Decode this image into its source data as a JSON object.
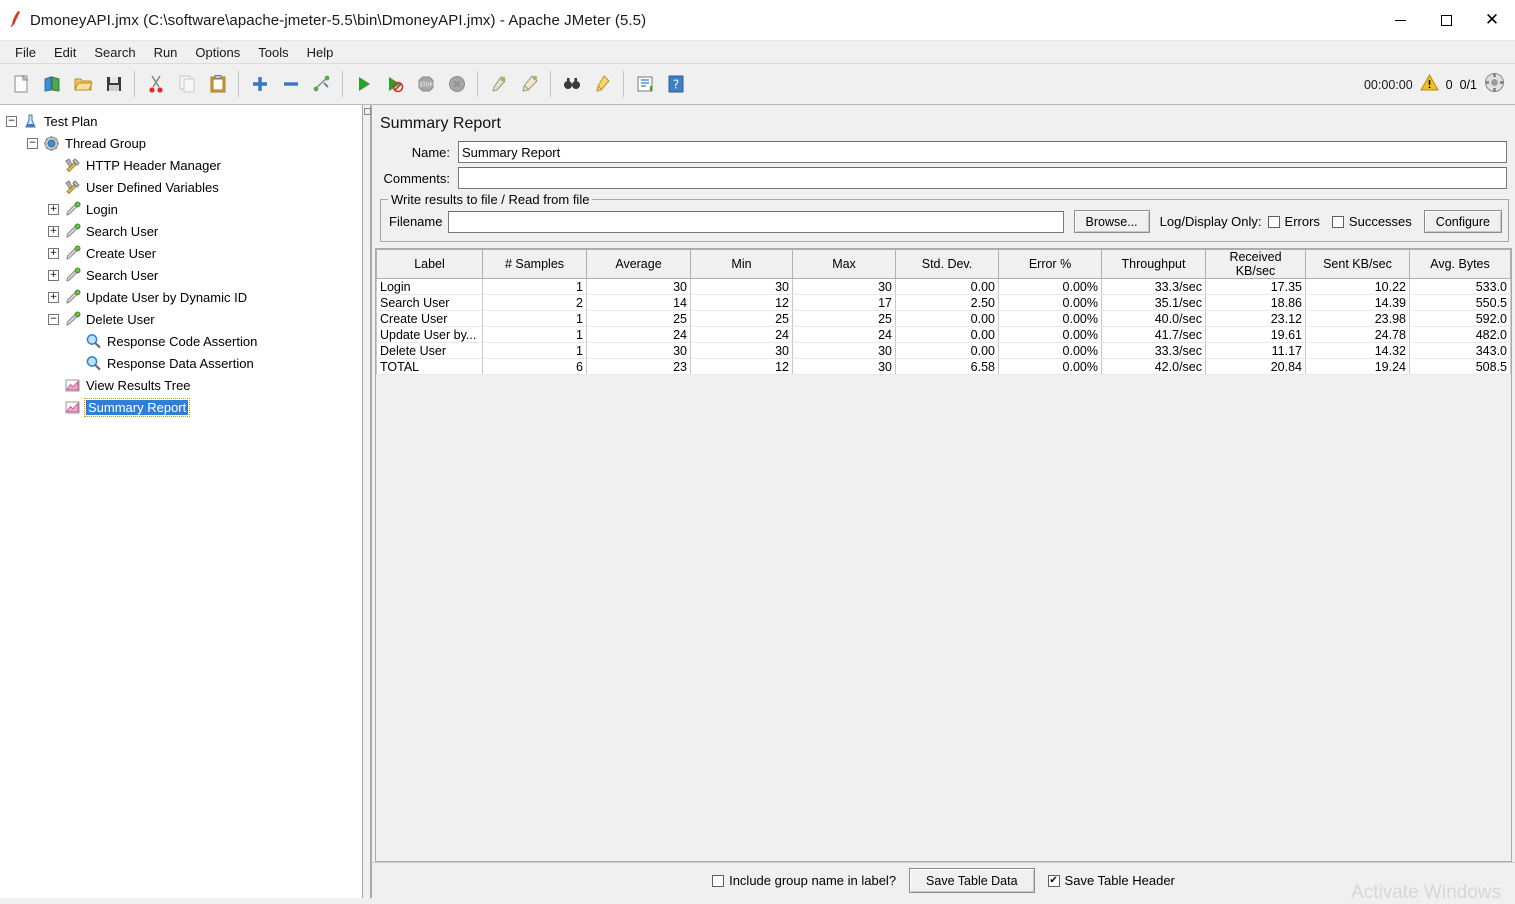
{
  "window": {
    "title": "DmoneyAPI.jmx (C:\\software\\apache-jmeter-5.5\\bin\\DmoneyAPI.jmx) - Apache JMeter (5.5)",
    "app_icon": "jmeter-feather-icon",
    "minimize": "minimize-icon",
    "maximize": "maximize-icon",
    "close": "close-icon"
  },
  "menu": {
    "items": [
      "File",
      "Edit",
      "Search",
      "Run",
      "Options",
      "Tools",
      "Help"
    ]
  },
  "toolbar": {
    "buttons": [
      {
        "name": "new-icon",
        "group": 0
      },
      {
        "name": "templates-icon",
        "group": 0
      },
      {
        "name": "open-icon",
        "group": 0
      },
      {
        "name": "save-icon",
        "group": 0
      },
      {
        "name": "cut-icon",
        "group": 1
      },
      {
        "name": "copy-icon",
        "group": 1
      },
      {
        "name": "paste-icon",
        "group": 1
      },
      {
        "name": "expand-icon",
        "group": 2
      },
      {
        "name": "collapse-icon",
        "group": 2
      },
      {
        "name": "toggle-icon",
        "group": 2
      },
      {
        "name": "start-icon",
        "group": 3
      },
      {
        "name": "start-no-timers-icon",
        "group": 3
      },
      {
        "name": "stop-icon",
        "group": 3
      },
      {
        "name": "shutdown-icon",
        "group": 3
      },
      {
        "name": "clear-icon",
        "group": 4
      },
      {
        "name": "clear-all-icon",
        "group": 4
      },
      {
        "name": "search-icon",
        "group": 5
      },
      {
        "name": "reset-search-icon",
        "group": 5
      },
      {
        "name": "function-helper-icon",
        "group": 6
      },
      {
        "name": "help-icon",
        "group": 6
      }
    ],
    "timer": "00:00:00",
    "warning_icon": "warning-triangle-icon",
    "error_count": "0",
    "thread_count": "0/1",
    "status_icon": "thread-status-icon"
  },
  "tree": {
    "nodes": [
      {
        "label": "Test Plan",
        "depth": 0,
        "icon": "test-plan-icon",
        "handle": "minus",
        "selected": false
      },
      {
        "label": "Thread Group",
        "depth": 1,
        "icon": "thread-group-icon",
        "handle": "minus",
        "selected": false
      },
      {
        "label": "HTTP Header Manager",
        "depth": 2,
        "icon": "config-element-icon",
        "handle": "none",
        "selected": false
      },
      {
        "label": "User Defined Variables",
        "depth": 2,
        "icon": "config-element-icon",
        "handle": "none",
        "selected": false
      },
      {
        "label": "Login",
        "depth": 2,
        "icon": "http-sampler-icon",
        "handle": "plus",
        "selected": false
      },
      {
        "label": "Search User",
        "depth": 2,
        "icon": "http-sampler-icon",
        "handle": "plus",
        "selected": false
      },
      {
        "label": "Create User",
        "depth": 2,
        "icon": "http-sampler-icon",
        "handle": "plus",
        "selected": false
      },
      {
        "label": "Search User",
        "depth": 2,
        "icon": "http-sampler-icon",
        "handle": "plus",
        "selected": false
      },
      {
        "label": "Update User by Dynamic ID",
        "depth": 2,
        "icon": "http-sampler-icon",
        "handle": "plus",
        "selected": false
      },
      {
        "label": "Delete User",
        "depth": 2,
        "icon": "http-sampler-icon",
        "handle": "minus",
        "selected": false
      },
      {
        "label": "Response Code Assertion",
        "depth": 3,
        "icon": "assertion-icon",
        "handle": "none",
        "selected": false
      },
      {
        "label": "Response Data Assertion",
        "depth": 3,
        "icon": "assertion-icon",
        "handle": "none",
        "selected": false
      },
      {
        "label": "View Results Tree",
        "depth": 2,
        "icon": "listener-icon",
        "handle": "none",
        "selected": false
      },
      {
        "label": "Summary Report",
        "depth": 2,
        "icon": "listener-icon",
        "handle": "none",
        "selected": true
      }
    ]
  },
  "panel": {
    "title": "Summary Report",
    "name_label": "Name:",
    "name_value": "Summary Report",
    "comments_label": "Comments:",
    "comments_value": "",
    "file_group_title": "Write results to file / Read from file",
    "filename_label": "Filename",
    "filename_value": "",
    "browse_label": "Browse...",
    "log_display_label": "Log/Display Only:",
    "errors_label": "Errors",
    "errors_checked": false,
    "successes_label": "Successes",
    "successes_checked": false,
    "configure_label": "Configure"
  },
  "table": {
    "columns": [
      "Label",
      "# Samples",
      "Average",
      "Min",
      "Max",
      "Std. Dev.",
      "Error %",
      "Throughput",
      "Received KB/sec",
      "Sent KB/sec",
      "Avg. Bytes"
    ],
    "rows": [
      [
        "Login",
        "1",
        "30",
        "30",
        "30",
        "0.00",
        "0.00%",
        "33.3/sec",
        "17.35",
        "10.22",
        "533.0"
      ],
      [
        "Search User",
        "2",
        "14",
        "12",
        "17",
        "2.50",
        "0.00%",
        "35.1/sec",
        "18.86",
        "14.39",
        "550.5"
      ],
      [
        "Create User",
        "1",
        "25",
        "25",
        "25",
        "0.00",
        "0.00%",
        "40.0/sec",
        "23.12",
        "23.98",
        "592.0"
      ],
      [
        "Update User by...",
        "1",
        "24",
        "24",
        "24",
        "0.00",
        "0.00%",
        "41.7/sec",
        "19.61",
        "24.78",
        "482.0"
      ],
      [
        "Delete User",
        "1",
        "30",
        "30",
        "30",
        "0.00",
        "0.00%",
        "33.3/sec",
        "11.17",
        "14.32",
        "343.0"
      ],
      [
        "TOTAL",
        "6",
        "23",
        "12",
        "30",
        "6.58",
        "0.00%",
        "42.0/sec",
        "20.84",
        "19.24",
        "508.5"
      ]
    ]
  },
  "bottom": {
    "include_group_label": "Include group name in label?",
    "include_group_checked": false,
    "save_table_data_label": "Save Table Data",
    "save_table_header_label": "Save Table Header",
    "save_table_header_checked": true
  },
  "watermark": "Activate Windows",
  "colors": {
    "selection_blue": "#2f7fd8",
    "panel_gray": "#f0f0f0",
    "accent_red": "#d23c2a"
  }
}
